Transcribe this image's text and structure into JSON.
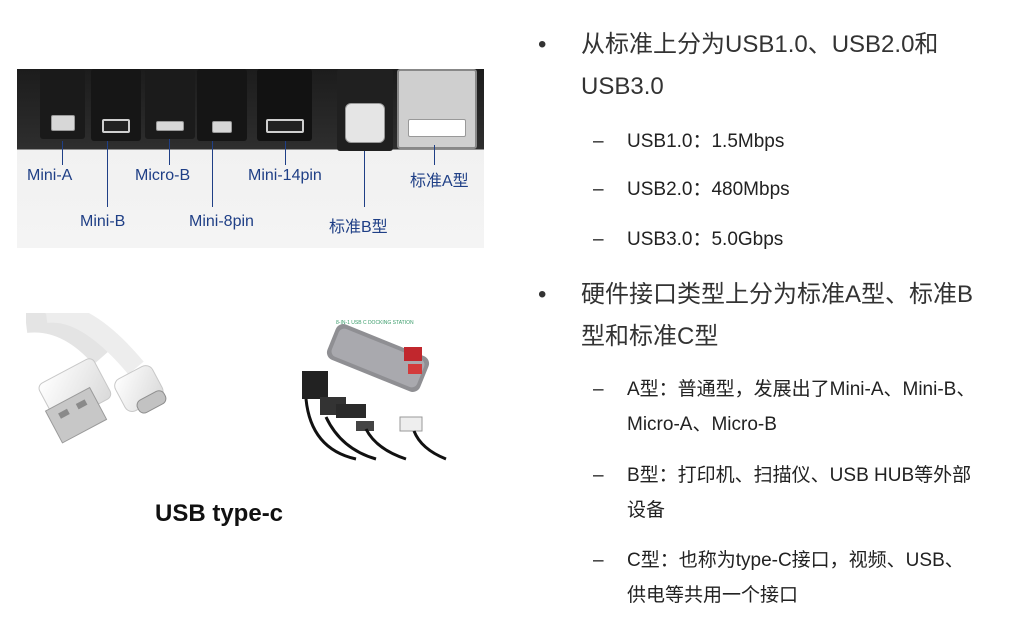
{
  "photo_labels": {
    "mini_a": "Mini-A",
    "mini_b": "Mini-B",
    "micro_b": "Micro-B",
    "mini_8pin": "Mini-8pin",
    "mini_14pin": "Mini-14pin",
    "standard_b": "标准B型",
    "standard_a": "标准A型"
  },
  "dock_title": "8-IN-1 USB C DOCKING STATION",
  "caption": "USB type-c",
  "bullets": [
    {
      "line1": "从标准上分为USB1.0、USB2.0和",
      "line2": "USB3.0",
      "subs": [
        {
          "line1": "USB1.0：1.5Mbps"
        },
        {
          "line1": "USB2.0：480Mbps"
        },
        {
          "line1": "USB3.0：5.0Gbps"
        }
      ]
    },
    {
      "line1": "硬件接口类型上分为标准A型、标准B",
      "line2": "型和标准C型",
      "subs": [
        {
          "line1": "A型：普通型，发展出了Mini-A、Mini-B、",
          "line2": "Micro-A、Micro-B"
        },
        {
          "line1": "B型：打印机、扫描仪、USB HUB等外部",
          "line2": "设备"
        },
        {
          "line1": "C型：也称为type-C接口，视频、USB、",
          "line2": "供电等共用一个接口"
        }
      ]
    }
  ],
  "glyphs": {
    "bullet": "•",
    "dash": "–"
  }
}
